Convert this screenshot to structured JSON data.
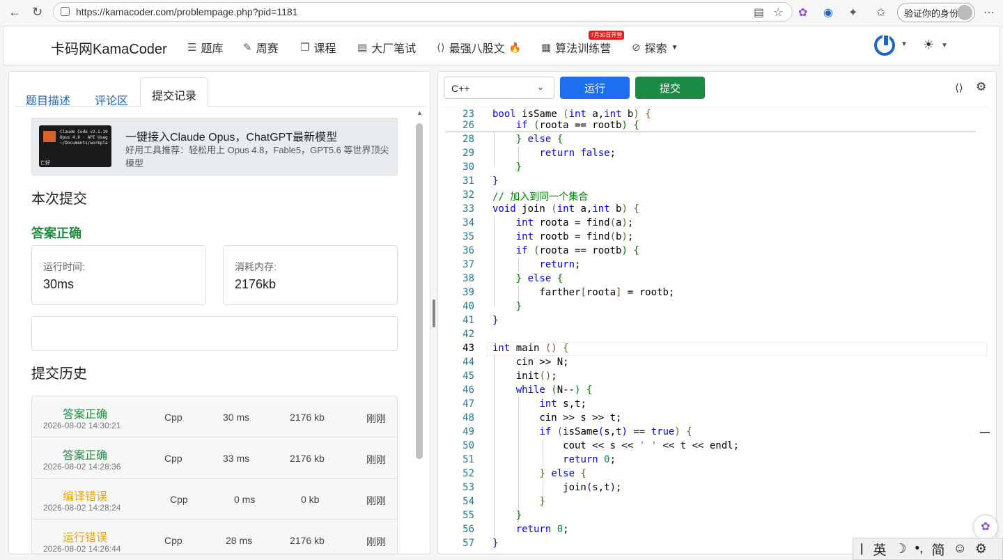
{
  "browser": {
    "url": "https://kamacoder.com/problempage.php?pid=1181",
    "verify_label": "验证你的身份"
  },
  "site": {
    "brand": "卡码网KamaCoder",
    "nav": [
      {
        "label": "题库",
        "icon": "list-icon"
      },
      {
        "label": "周赛",
        "icon": "pencil-icon"
      },
      {
        "label": "课程",
        "icon": "copy-icon"
      },
      {
        "label": "大厂笔试",
        "icon": "document-icon"
      },
      {
        "label": "最强八股文",
        "icon": "code-icon"
      },
      {
        "label": "算法训练营",
        "icon": "calendar-icon"
      },
      {
        "label": "探索",
        "icon": "compass-icon"
      }
    ],
    "fire": "🔥",
    "badge": "7月30日开营"
  },
  "left": {
    "tabs": [
      "题目描述",
      "评论区",
      "提交记录"
    ],
    "ad": {
      "title": "一键接入Claude Opus，ChatGPT最新模型",
      "subtitle": "好用工具推荐：轻松用上 Opus 4.8，Fable5，GPT5.6 等世界顶尖模型",
      "img_line1": "Claude Code v2.1.19",
      "img_line2": "Opus 4.8 · API Usag",
      "img_line3": "~/Documents/workpla",
      "img_corner": "亡好"
    },
    "current_title": "本次提交",
    "result": "答案正确",
    "runtime_label": "运行时间:",
    "runtime_value": "30ms",
    "memory_label": "消耗内存:",
    "memory_value": "2176kb",
    "history_title": "提交历史",
    "history": [
      {
        "status": "答案正确",
        "time": "2026-08-02 14:30:21",
        "lang": "Cpp",
        "runtime": "30 ms",
        "memory": "2176 kb",
        "ago": "刚刚",
        "color": "#1a8a3a"
      },
      {
        "status": "答案正确",
        "time": "2026-08-02 14:28:36",
        "lang": "Cpp",
        "runtime": "33 ms",
        "memory": "2176 kb",
        "ago": "刚刚",
        "color": "#1a8a3a"
      },
      {
        "status": "编译错误",
        "time": "2026-08-02 14:28:24",
        "lang": "Cpp",
        "runtime": "0 ms",
        "memory": "0 kb",
        "ago": "刚刚",
        "color": "#f0a500"
      },
      {
        "status": "运行错误",
        "time": "2026-08-02 14:26:44",
        "lang": "Cpp",
        "runtime": "28 ms",
        "memory": "2176 kb",
        "ago": "刚刚",
        "color": "#f0a500"
      }
    ]
  },
  "right": {
    "language": "C++",
    "run_label": "运行",
    "submit_label": "提交",
    "line_numbers": [
      "23",
      "26",
      "28",
      "29",
      "30",
      "31",
      "32",
      "33",
      "34",
      "35",
      "36",
      "37",
      "38",
      "39",
      "40",
      "41",
      "42",
      "43",
      "44",
      "45",
      "46",
      "47",
      "48",
      "49",
      "50",
      "51",
      "52",
      "53",
      "54",
      "55",
      "56",
      "57"
    ]
  },
  "ime": [
    "英",
    "简"
  ]
}
